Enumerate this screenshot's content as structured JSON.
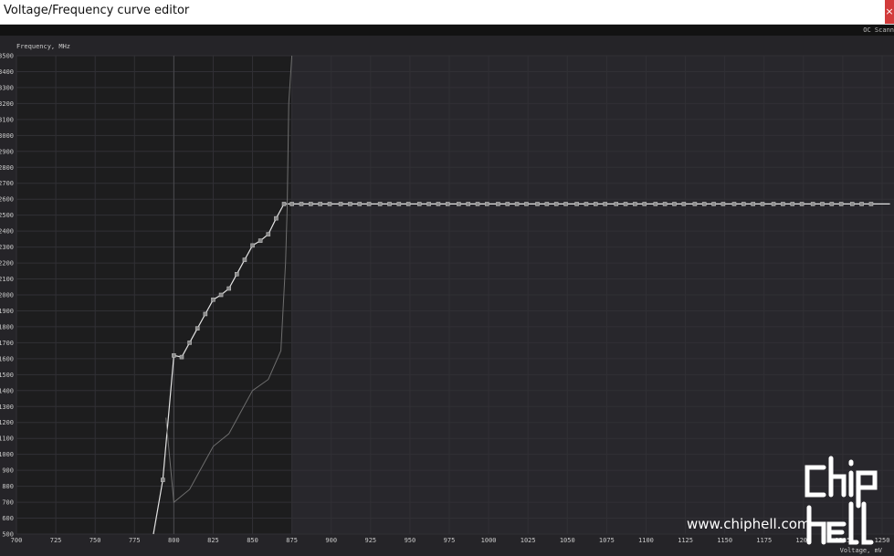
{
  "window": {
    "title": "Voltage/Frequency curve editor",
    "close_label": "×",
    "oc_scanner_label": "OC Scann"
  },
  "chart_data": {
    "type": "line",
    "ylabel": "Frequency, MHz",
    "xlabel": "Voltage, mV",
    "xlim": [
      700,
      1250
    ],
    "ylim": [
      500,
      3500
    ],
    "x_ticks": [
      "700",
      "725",
      "750",
      "775",
      "800",
      "825",
      "850",
      "875",
      "900",
      "925",
      "950",
      "975",
      "1000",
      "1025",
      "1050",
      "1075",
      "1100",
      "1125",
      "1150",
      "1175",
      "1200",
      "1225",
      "1250"
    ],
    "y_ticks": [
      "500",
      "600",
      "700",
      "800",
      "900",
      "1000",
      "1100",
      "1200",
      "1300",
      "1400",
      "1500",
      "1600",
      "1700",
      "1800",
      "1900",
      "2000",
      "2100",
      "2200",
      "2300",
      "2400",
      "2500",
      "2600",
      "2700",
      "2800",
      "2900",
      "3000",
      "3100",
      "3200",
      "3300",
      "3400",
      "3500"
    ],
    "shaded_until_voltage": 875,
    "cursor_voltage": 800,
    "grid": true,
    "series": [
      {
        "color": "#e2e2e2",
        "markers": true,
        "points": [
          [
            787,
            500
          ],
          [
            793,
            840
          ],
          [
            800,
            1620
          ],
          [
            805,
            1610
          ],
          [
            810,
            1700
          ],
          [
            815,
            1790
          ],
          [
            820,
            1880
          ],
          [
            825,
            1970
          ],
          [
            830,
            2000
          ],
          [
            835,
            2040
          ],
          [
            840,
            2130
          ],
          [
            845,
            2220
          ],
          [
            850,
            2310
          ],
          [
            855,
            2340
          ],
          [
            860,
            2380
          ],
          [
            865,
            2480
          ],
          [
            870,
            2570
          ],
          [
            875,
            2570
          ]
        ],
        "flat_markers": [
          881,
          887,
          893,
          899,
          906,
          912,
          918,
          924,
          931,
          937,
          943,
          949,
          956,
          962,
          968,
          974,
          981,
          987,
          993,
          999,
          1006,
          1012,
          1018,
          1024,
          1031,
          1037,
          1043,
          1049,
          1056,
          1062,
          1068,
          1074,
          1081,
          1087,
          1093,
          1099,
          1106,
          1112,
          1118,
          1124,
          1131,
          1137,
          1143,
          1149,
          1156,
          1162,
          1168,
          1174,
          1181,
          1187,
          1193,
          1199,
          1206,
          1212,
          1218,
          1224,
          1231,
          1237,
          1243
        ],
        "flat_value": 2570,
        "flat_end": 1255
      },
      {
        "color": "#6e6e6e",
        "markers": false,
        "points": [
          [
            795,
            1230
          ],
          [
            800,
            700
          ],
          [
            810,
            780
          ],
          [
            825,
            1050
          ],
          [
            835,
            1130
          ],
          [
            850,
            1400
          ],
          [
            860,
            1470
          ],
          [
            868,
            1650
          ],
          [
            871,
            2200
          ],
          [
            872,
            2550
          ],
          [
            873,
            3200
          ],
          [
            875,
            3500
          ]
        ]
      }
    ]
  },
  "watermark": {
    "url_text": "www.chiphell.com",
    "logo": "chiphell-logo"
  }
}
